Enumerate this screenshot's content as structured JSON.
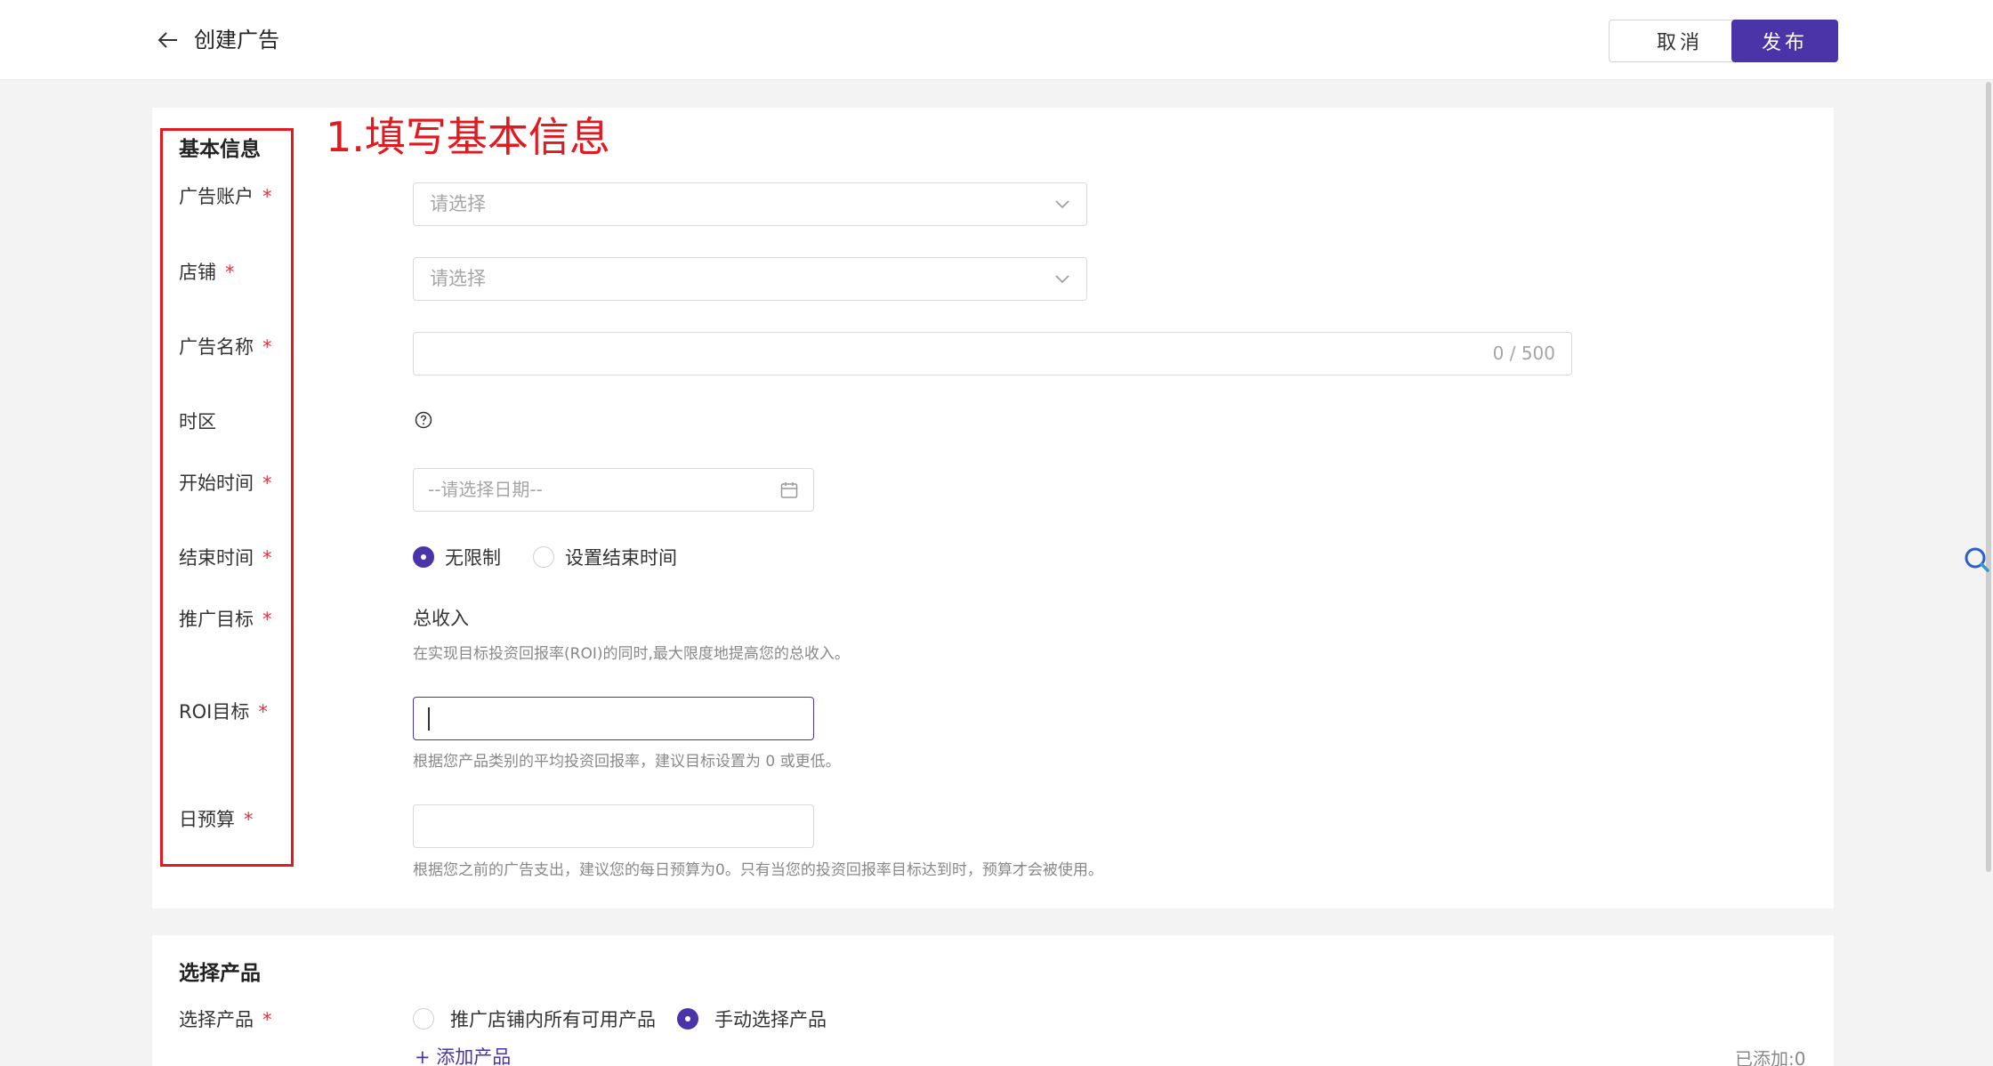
{
  "header": {
    "title": "创建广告",
    "cancel_label": "取消",
    "publish_label": "发布"
  },
  "annotation": "1.填写基本信息",
  "basic_info": {
    "section_title": "基本信息",
    "required_mark": "*",
    "fields": {
      "ad_account": {
        "label": "广告账户",
        "placeholder": "请选择"
      },
      "store": {
        "label": "店铺",
        "placeholder": "请选择"
      },
      "ad_name": {
        "label": "广告名称",
        "counter": "0 / 500"
      },
      "timezone": {
        "label": "时区"
      },
      "start_time": {
        "label": "开始时间",
        "placeholder": "--请选择日期--"
      },
      "end_time": {
        "label": "结束时间",
        "options": [
          "无限制",
          "设置结束时间"
        ],
        "selected": "无限制"
      },
      "promo_goal": {
        "label": "推广目标",
        "value": "总收入",
        "description": "在实现目标投资回报率(ROI)的同时,最大限度地提高您的总收入。"
      },
      "roi_goal": {
        "label": "ROI目标",
        "hint": "根据您产品类别的平均投资回报率，建议目标设置为 0 或更低。"
      },
      "daily_budget": {
        "label": "日预算",
        "hint": "根据您之前的广告支出，建议您的每日预算为0。只有当您的投资回报率目标达到时，预算才会被使用。"
      }
    }
  },
  "products": {
    "section_title": "选择产品",
    "field_label": "选择产品",
    "options": [
      "推广店铺内所有可用产品",
      "手动选择产品"
    ],
    "selected": "手动选择产品",
    "add_label": "+ 添加产品",
    "added_count": "已添加:0"
  },
  "colors": {
    "accent": "#4b33a8",
    "required": "#e2323a",
    "annotation": "#e2191f"
  },
  "icons": {
    "back": "arrow-left-icon",
    "dropdown": "chevron-down-icon",
    "help": "question-circle-icon",
    "calendar": "calendar-icon",
    "search": "search-icon"
  }
}
